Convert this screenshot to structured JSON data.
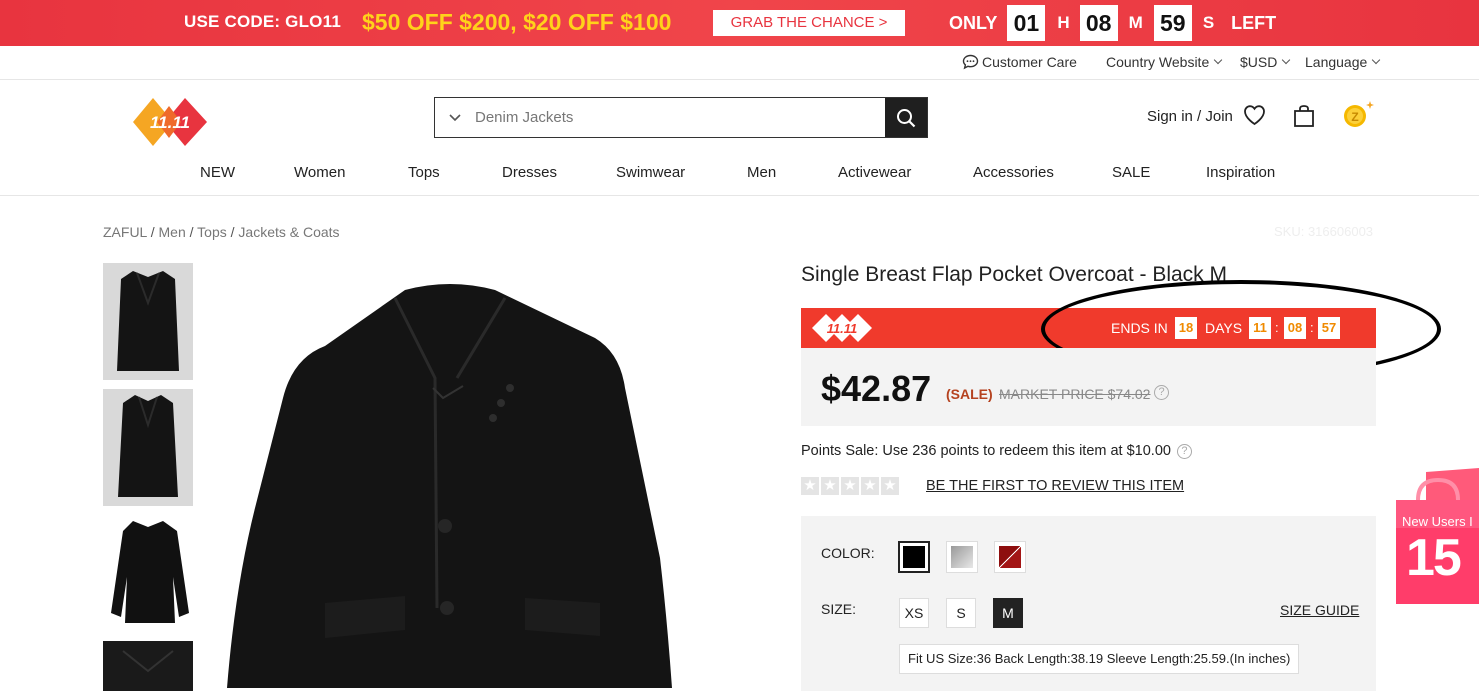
{
  "promo": {
    "code": "USE CODE: GLO11",
    "deal": "$50 OFF $200, $20 OFF $100",
    "grab": "GRAB THE CHANCE >",
    "only": "ONLY",
    "hours": "01",
    "h": "H",
    "minutes": "08",
    "m": "M",
    "seconds": "59",
    "s": "S",
    "left": "LEFT"
  },
  "utility": {
    "customer_care": "Customer Care",
    "country": "Country Website",
    "currency": "$USD",
    "language": "Language"
  },
  "header": {
    "logo_text": "11.11",
    "search_placeholder": "Denim Jackets",
    "signin": "Sign in / Join"
  },
  "nav": [
    "NEW",
    "Women",
    "Tops",
    "Dresses",
    "Swimwear",
    "Men",
    "Activewear",
    "Accessories",
    "SALE",
    "Inspiration"
  ],
  "breadcrumb": {
    "items": [
      "ZAFUL",
      "Men",
      "Tops",
      "Jackets & Coats"
    ],
    "sku": "SKU: 316606003"
  },
  "product": {
    "title": "Single Breast Flap Pocket Overcoat - Black M",
    "flash_badge": "11.11",
    "ends_in": "ENDS IN",
    "days_val": "18",
    "days": "DAYS",
    "hh": "11",
    "mm": "08",
    "ss": "57",
    "price": "$42.87",
    "sale": "(SALE)",
    "market": "MARKET PRICE $74.02",
    "points": "Points Sale: Use 236 points to redeem this item at $10.00",
    "review": "BE THE FIRST TO REVIEW THIS ITEM",
    "rating": 0,
    "color_label": "COLOR:",
    "size_label": "SIZE:",
    "sizes": [
      "XS",
      "S",
      "M"
    ],
    "size_guide": "SIZE GUIDE",
    "fit": "Fit US Size:36   Back Length:38.19   Sleeve Length:25.59.(In inches)"
  },
  "side_banner": {
    "text": "New Users I",
    "number": "15"
  },
  "colors": {
    "promo_red": "#e8343f",
    "deal_yellow": "#ffd21a",
    "flash_red": "#f03a2c",
    "countdown_orange": "#f08a00",
    "sale_brown": "#b5421f"
  }
}
